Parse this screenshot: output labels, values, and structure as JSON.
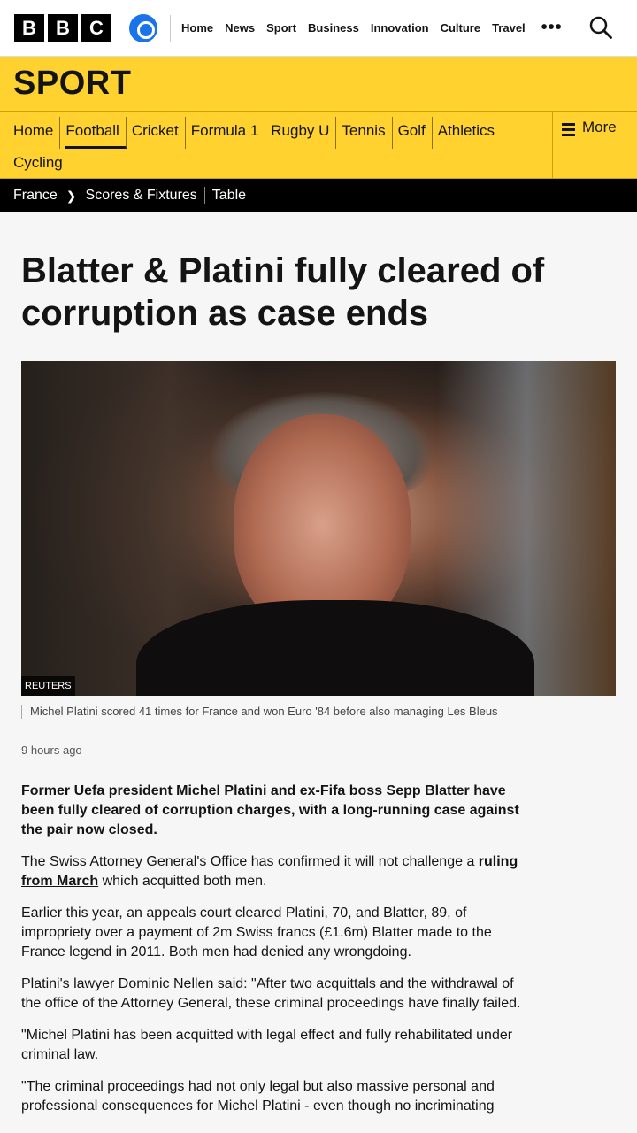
{
  "header": {
    "logo": [
      "B",
      "B",
      "C"
    ],
    "nav": [
      "Home",
      "News",
      "Sport",
      "Business",
      "Innovation",
      "Culture",
      "Travel"
    ],
    "more_dots": "•••"
  },
  "sport_section": {
    "title": "SPORT",
    "nav_items": [
      "Home",
      "Football",
      "Cricket",
      "Formula 1",
      "Rugby U",
      "Tennis",
      "Golf",
      "Athletics",
      "Cycling"
    ],
    "active": "Football",
    "more_label": "More"
  },
  "subnav": {
    "breadcrumb_root": "France",
    "links": [
      "Scores & Fixtures",
      "Table"
    ]
  },
  "article": {
    "headline": "Blatter & Platini fully cleared of corruption as case ends",
    "image_credit": "REUTERS",
    "caption": "Michel Platini scored 41 times for France and won Euro '84 before also managing Les Bleus",
    "timestamp": "9 hours ago",
    "lead": "Former Uefa president Michel Platini and ex-Fifa boss Sepp Blatter have been fully cleared of corruption charges, with a long-running case against the pair now closed.",
    "p1_before": "The Swiss Attorney General's Office has confirmed it will not challenge a ",
    "p1_link": "ruling from March",
    "p1_after": " which acquitted both men.",
    "p2": "Earlier this year, an appeals court cleared Platini, 70, and Blatter, 89, of impropriety over a payment of 2m Swiss francs (£1.6m) Blatter made to the France legend in 2011. Both men had denied any wrongdoing.",
    "p3": "Platini's lawyer Dominic Nellen said: \"After two acquittals and the withdrawal of the office of the Attorney General, these criminal proceedings have finally failed.",
    "p4": "\"Michel Platini has been acquitted with legal effect and fully rehabilitated under criminal law.",
    "p5": "\"The criminal proceedings had not only legal but also massive personal and professional consequences for Michel Platini - even though no incriminating"
  }
}
